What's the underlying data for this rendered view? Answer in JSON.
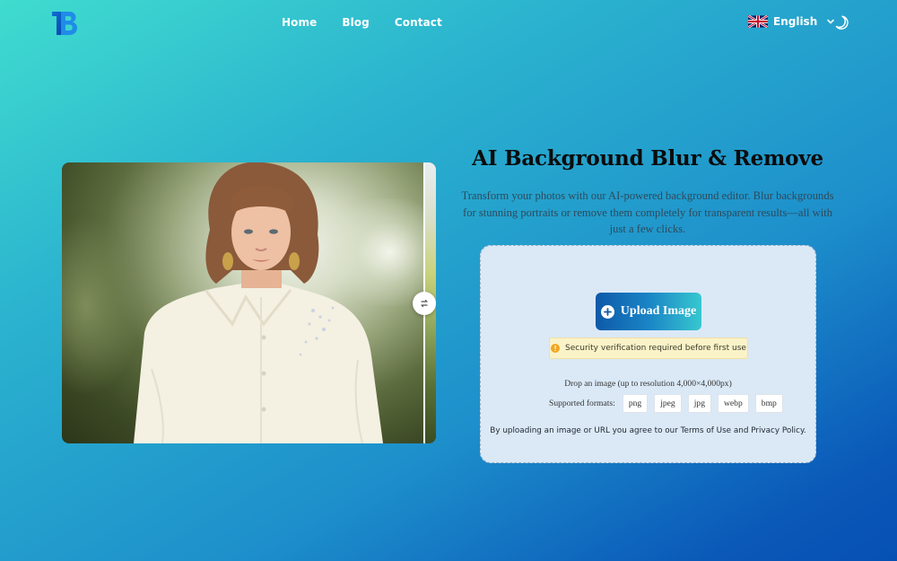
{
  "header": {
    "logo_text": "TB",
    "nav": [
      "Home",
      "Blog",
      "Contact"
    ],
    "language": "English",
    "language_flag": "uk-flag-icon",
    "theme_icon": "moon-icon"
  },
  "hero": {
    "title": "AI Background Blur & Remove",
    "description": "Transform your photos with our AI-powered background editor. Blur backgrounds for stunning portraits or remove them completely for transparent results—all with just a few clicks."
  },
  "upload": {
    "button_label": "Upload Image",
    "security_notice": "Security verification required before first use",
    "drop_text": "Drop an image (up to resolution 4,000×4,000px)",
    "formats_label": "Supported formats:",
    "formats": [
      "png",
      "jpeg",
      "jpg",
      "webp",
      "bmp"
    ],
    "agreement": "By uploading an image or URL you agree to our Terms of Use and Privacy Policy."
  },
  "colors": {
    "accent_start": "#0d5aa8",
    "accent_end": "#37c8cf",
    "background_top": "#40dccf",
    "background_bottom": "#0650b3",
    "warning": "#f0a823"
  }
}
